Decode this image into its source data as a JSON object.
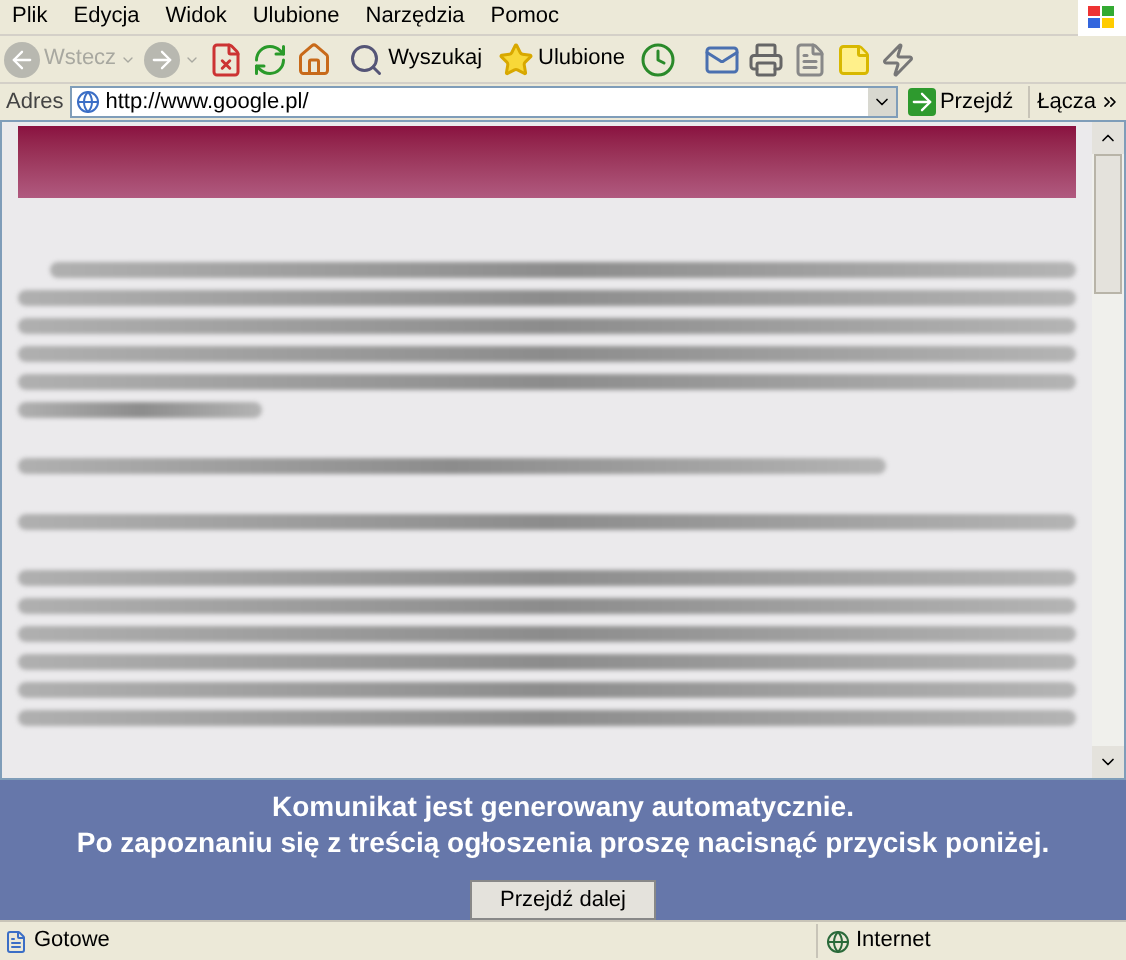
{
  "menu": [
    "Plik",
    "Edycja",
    "Widok",
    "Ulubione",
    "Narzędzia",
    "Pomoc"
  ],
  "toolbar": {
    "back": {
      "label": "Wstecz",
      "disabled": true
    },
    "search": "Wyszukaj",
    "favorites": "Ulubione"
  },
  "address": {
    "label": "Adres",
    "url": "http://www.google.pl/",
    "go": "Przejdź",
    "links": "Łącza"
  },
  "notice": {
    "lines": [
      "Komunikat jest generowany automatycznie.",
      "Po zapoznaniu się z treścią ogłoszenia proszę nacisnąć przycisk poniżej."
    ],
    "button": "Przejdź dalej"
  },
  "status": {
    "text": "Gotowe",
    "zone": "Internet"
  }
}
